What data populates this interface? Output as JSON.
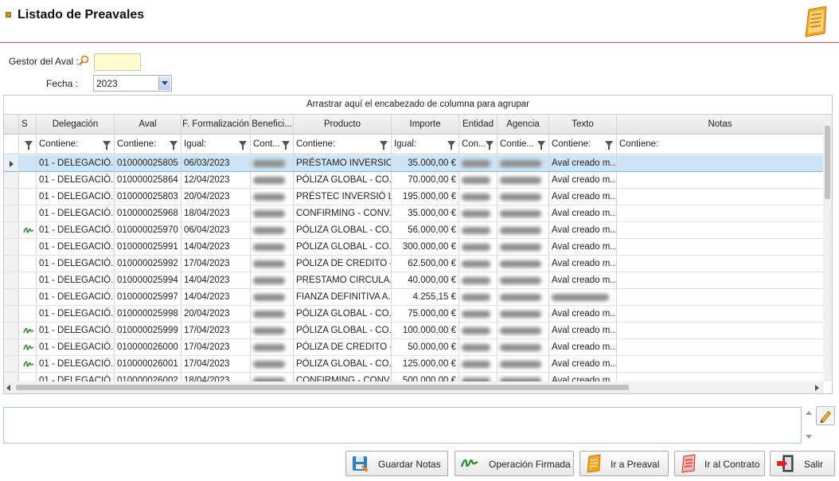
{
  "window": {
    "title": "Listado de Preavales"
  },
  "filters": {
    "gestor_label": "Gestor del Aval :",
    "gestor_value": "",
    "fecha_label": "Fecha :",
    "fecha_value": "2023"
  },
  "grid": {
    "group_panel_text": "Arrastrar aquí el encabezado de columna para agrupar",
    "columns": [
      {
        "label": "",
        "filter": ""
      },
      {
        "label": "S",
        "filter": ""
      },
      {
        "label": "Delegación",
        "filter": "Contiene:"
      },
      {
        "label": "Aval",
        "filter": "Contiene:"
      },
      {
        "label": "F. Formalización",
        "filter": "Igual:"
      },
      {
        "label": "Benefici...",
        "filter": "Cont..."
      },
      {
        "label": "Producto",
        "filter": "Contiene:"
      },
      {
        "label": "Importe",
        "filter": "Igual:"
      },
      {
        "label": "Entidad",
        "filter": "Con..."
      },
      {
        "label": "Agencia",
        "filter": "Contie..."
      },
      {
        "label": "Texto",
        "filter": "Contiene:"
      },
      {
        "label": "Notas",
        "filter": "Contiene:"
      }
    ],
    "rows": [
      {
        "signed": false,
        "selected": true,
        "delegacion": "01 - DELEGACIÓ...",
        "aval": "010000025805",
        "fecha": "06/03/2023",
        "producto": "PRÉSTAMO INVERSION",
        "importe": "35.000,00 €",
        "texto": "Aval creado m..."
      },
      {
        "signed": false,
        "selected": false,
        "delegacion": "01 - DELEGACIÓ...",
        "aval": "010000025864",
        "fecha": "12/04/2023",
        "producto": "PÓLIZA GLOBAL - CO...",
        "importe": "70.000,00 €",
        "texto": "Aval creado m..."
      },
      {
        "signed": false,
        "selected": false,
        "delegacion": "01 - DELEGACIÓ...",
        "aval": "010000025803",
        "fecha": "20/04/2023",
        "producto": "PRÉSTEC INVERSIÓ LÍ...",
        "importe": "195.000,00 €",
        "texto": "Aval creado m..."
      },
      {
        "signed": false,
        "selected": false,
        "delegacion": "01 - DELEGACIÓ...",
        "aval": "010000025968",
        "fecha": "18/04/2023",
        "producto": "CONFIRMING - CONV...",
        "importe": "35.000,00 €",
        "texto": "Aval creado m..."
      },
      {
        "signed": true,
        "selected": false,
        "delegacion": "01 - DELEGACIÓ...",
        "aval": "010000025970",
        "fecha": "06/04/2023",
        "producto": "PÓLIZA GLOBAL - CO...",
        "importe": "56.000,00 €",
        "texto": "Aval creado m..."
      },
      {
        "signed": false,
        "selected": false,
        "delegacion": "01 - DELEGACIÓ...",
        "aval": "010000025991",
        "fecha": "14/04/2023",
        "producto": "PÓLIZA GLOBAL - CO...",
        "importe": "300.000,00 €",
        "texto": "Aval creado m..."
      },
      {
        "signed": false,
        "selected": false,
        "delegacion": "01 - DELEGACIÓ...",
        "aval": "010000025992",
        "fecha": "17/04/2023",
        "producto": "PÓLIZA DE CREDITO -...",
        "importe": "62.500,00 €",
        "texto": "Aval creado m..."
      },
      {
        "signed": false,
        "selected": false,
        "delegacion": "01 - DELEGACIÓ...",
        "aval": "010000025994",
        "fecha": "14/04/2023",
        "producto": "PRESTAMO CIRCULA...",
        "importe": "40.000,00 €",
        "texto": "Aval creado m..."
      },
      {
        "signed": false,
        "selected": false,
        "delegacion": "01 - DELEGACIÓ...",
        "aval": "010000025997",
        "fecha": "14/04/2023",
        "producto": "FIANZA DEFINITIVA A...",
        "importe": "4.255,15 €",
        "texto": ""
      },
      {
        "signed": false,
        "selected": false,
        "delegacion": "01 - DELEGACIÓ...",
        "aval": "010000025998",
        "fecha": "20/04/2023",
        "producto": "PÓLIZA GLOBAL - CO...",
        "importe": "75.000,00 €",
        "texto": "Aval creado m..."
      },
      {
        "signed": true,
        "selected": false,
        "delegacion": "01 - DELEGACIÓ...",
        "aval": "010000025999",
        "fecha": "17/04/2023",
        "producto": "PÓLIZA GLOBAL - CO...",
        "importe": "100.000,00 €",
        "texto": "Aval creado m..."
      },
      {
        "signed": true,
        "selected": false,
        "delegacion": "01 - DELEGACIÓ...",
        "aval": "010000026000",
        "fecha": "17/04/2023",
        "producto": "PÓLIZA DE CREDITO -...",
        "importe": "50.000,00 €",
        "texto": "Aval creado m..."
      },
      {
        "signed": true,
        "selected": false,
        "delegacion": "01 - DELEGACIÓ...",
        "aval": "010000026001",
        "fecha": "17/04/2023",
        "producto": "PÓLIZA GLOBAL - CO...",
        "importe": "125.000,00 €",
        "texto": "Aval creado m..."
      },
      {
        "signed": false,
        "selected": false,
        "delegacion": "01 - DELEGACIÓ",
        "aval": "010000026002",
        "fecha": "18/04/2023",
        "producto": "CONFIRMING - CONV...",
        "importe": "500.000,00 €",
        "texto": "Aval creado m..."
      }
    ]
  },
  "notes": {
    "value": ""
  },
  "buttons": {
    "guardar_notas": "Guardar Notas",
    "operacion_firmada": "Operación Firmada",
    "ir_preaval": "Ir a Preaval",
    "ir_contrato": "Ir al Contrato",
    "salir": "Salir"
  },
  "icons": {
    "header": "document-list-icon",
    "gestor": "search-icon",
    "signed": "signature-icon",
    "edit_notes": "pencil-icon"
  },
  "colors": {
    "accent_line": "#d9534f",
    "selected_row": "#cce4f5",
    "gestor_input_bg": "#fffbd0"
  }
}
